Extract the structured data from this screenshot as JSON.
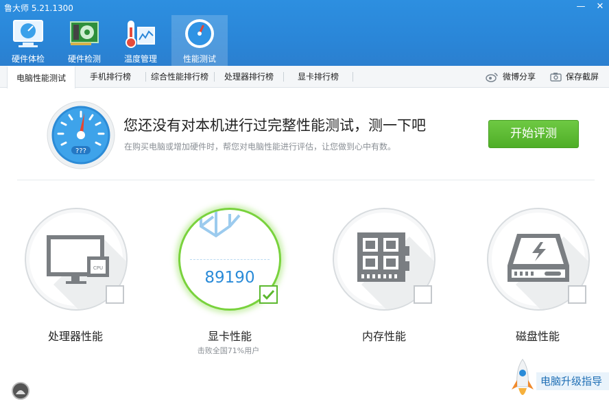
{
  "window": {
    "title": "鲁大师 5.21.1300",
    "controls": [
      "—",
      "✕"
    ]
  },
  "nav": [
    {
      "label": "硬件体检",
      "icon": "monitor-check-icon"
    },
    {
      "label": "硬件检测",
      "icon": "hardware-board-icon"
    },
    {
      "label": "温度管理",
      "icon": "thermometer-icon"
    },
    {
      "label": "性能测试",
      "icon": "speedometer-icon",
      "active": true
    }
  ],
  "subtabs": [
    {
      "label": "电脑性能测试",
      "active": true
    },
    {
      "label": "手机排行榜"
    },
    {
      "label": "综合性能排行榜"
    },
    {
      "label": "处理器排行榜"
    },
    {
      "label": "显卡排行榜"
    }
  ],
  "actions": {
    "weibo": "微博分享",
    "screenshot": "保存截屏"
  },
  "banner": {
    "headline": "您还没有对本机进行过完整性能测试，测一下吧",
    "subline": "在购买电脑或增加硬件时，帮您对电脑性能进行评估，让您做到心中有数。",
    "button": "开始评测",
    "gauge_text": "???"
  },
  "cards": [
    {
      "label": "处理器性能",
      "icon": "cpu-monitor-icon",
      "checked": false
    },
    {
      "label": "显卡性能",
      "score": "89190",
      "sub": "击败全国71%用户",
      "icon": "gpu-cube-icon",
      "checked": true
    },
    {
      "label": "内存性能",
      "icon": "memory-chip-icon",
      "checked": false
    },
    {
      "label": "磁盘性能",
      "icon": "disk-drive-icon",
      "checked": false
    }
  ],
  "upgrade": {
    "label": "电脑升级指导",
    "icon": "rocket-icon"
  },
  "colors": {
    "header": "#2b87d9",
    "accent_green": "#5cb82e",
    "score_blue": "#2a8bd8"
  }
}
